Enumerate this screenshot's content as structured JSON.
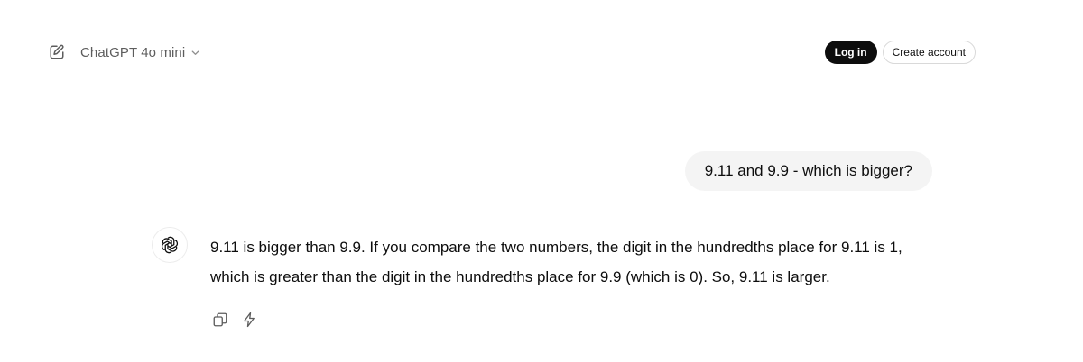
{
  "header": {
    "new_chat_icon": "edit-square-icon",
    "model_name": "ChatGPT 4o mini",
    "model_dropdown_icon": "chevron-down-icon",
    "login_label": "Log in",
    "create_account_label": "Create account"
  },
  "conversation": {
    "user_message": "9.11 and 9.9 - which is bigger?",
    "assistant_avatar_icon": "openai-logo-icon",
    "assistant_message": "9.11 is bigger than 9.9. If you compare the two numbers, the digit in the hundredths place for 9.11 is 1, which is greater than the digit in the hundredths place for 9.9 (which is 0). So, 9.11 is larger.",
    "actions": [
      {
        "name": "copy",
        "icon": "copy-icon"
      },
      {
        "name": "regenerate",
        "icon": "lightning-icon"
      }
    ]
  },
  "colors": {
    "background": "#ffffff",
    "text": "#0d0d0d",
    "muted_text": "#5d5d5d",
    "user_bubble": "#f4f4f4",
    "login_button": "#0d0d0d"
  }
}
